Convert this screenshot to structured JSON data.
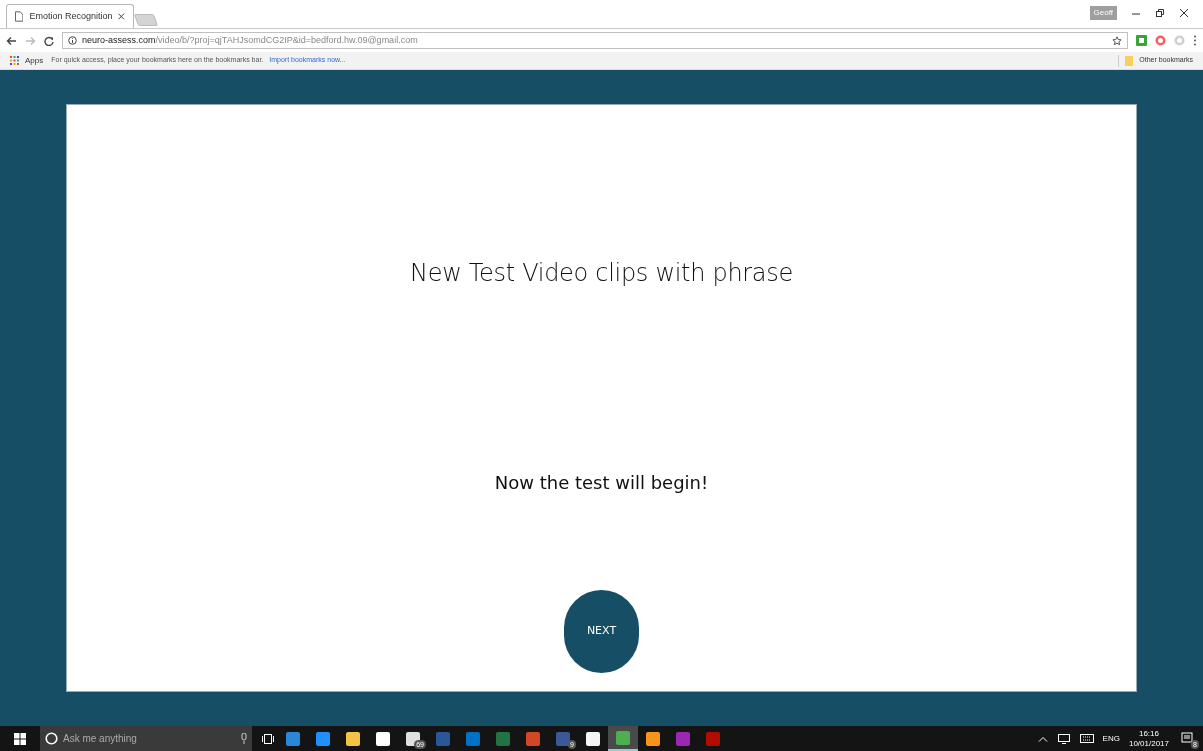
{
  "browser": {
    "tab_title": "Emotion Recognition",
    "profile": "Geoff",
    "url_domain": "neuro-assess.com",
    "url_path": "/video/b/?proj=qjTAHJsomdCG2IP&id=bedford.hw.09@gmail.com",
    "bookmarks": {
      "apps": "Apps",
      "hint": "For quick access, place your bookmarks here on the bookmarks bar.",
      "import_link": "Import bookmarks now...",
      "other": "Other bookmarks"
    }
  },
  "page": {
    "title": "New Test Video clips with phrase",
    "message": "Now the test will begin!",
    "button": "NEXT"
  },
  "taskbar": {
    "search_placeholder": "Ask me anything",
    "apps": [
      {
        "color": "#2b88d8",
        "selected": false
      },
      {
        "color": "#1e90ff",
        "selected": false
      },
      {
        "color": "#f3c443",
        "selected": false
      },
      {
        "color": "#ffffff",
        "selected": false
      },
      {
        "color": "#e0e0e0",
        "selected": false,
        "badge": "69"
      },
      {
        "color": "#2b579a",
        "selected": false
      },
      {
        "color": "#0072c6",
        "selected": false
      },
      {
        "color": "#217346",
        "selected": false
      },
      {
        "color": "#d24726",
        "selected": false
      },
      {
        "color": "#3b5998",
        "selected": false,
        "badge": "9"
      },
      {
        "color": "#f5f5f5",
        "selected": false
      },
      {
        "color": "#4caf50",
        "selected": true
      },
      {
        "color": "#f7941d",
        "selected": false
      },
      {
        "color": "#9c27b0",
        "selected": false
      },
      {
        "color": "#b30b00",
        "selected": false
      }
    ],
    "language": "ENG",
    "time": "16:16",
    "date": "10/01/2017",
    "notification_count": "8"
  }
}
